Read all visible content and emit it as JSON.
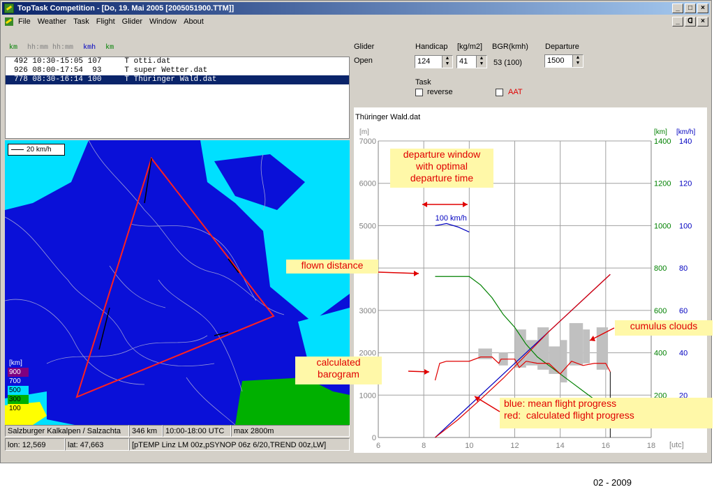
{
  "window": {
    "title": "TopTask Competition - [Do, 19. Mai 2005 [2005051900.TTM]]",
    "buttons": [
      "_",
      "□",
      "×"
    ],
    "mdi_buttons": [
      "_",
      "ᗡ",
      "×"
    ]
  },
  "menu": [
    "File",
    "Weather",
    "Task",
    "Flight",
    "Glider",
    "Window",
    "About"
  ],
  "list": {
    "headers": [
      {
        "text": "km",
        "color": "#008000"
      },
      {
        "text": "hh:mm hh:mm",
        "color": "#808080"
      },
      {
        "text": "kmh",
        "color": "#0000c0"
      },
      {
        "text": "km",
        "color": "#008000"
      }
    ],
    "rows": [
      "492 10:30-15:05 107     T otti.dat",
      "926 08:00-17:54  93     T super Wetter.dat",
      "778 08:30-16:14 100     T Thüringer Wald.dat"
    ],
    "selected_index": 2
  },
  "map": {
    "scale_label": "20 km/h",
    "legend_title": "[km]",
    "legend": [
      {
        "label": "900",
        "color": "#800080",
        "text_color": "#ffffff"
      },
      {
        "label": "700",
        "color": "#0a10d8",
        "text_color": "#ffffff"
      },
      {
        "label": "500",
        "color": "#00e0ff",
        "text_color": "#000000"
      },
      {
        "label": "300",
        "color": "#00b000",
        "text_color": "#000000"
      },
      {
        "label": "100",
        "color": "#ffff00",
        "text_color": "#000000"
      }
    ],
    "status1": [
      "Salzburger Kalkalpen / Salzachta",
      "346 km",
      "10:00-18:00 UTC",
      "max 2800m"
    ],
    "status2": [
      "lon: 12,569",
      "lat: 47,663",
      "[pTEMP Linz LM 00z,pSYNOP 06z 6/20,TREND 00z,LW]"
    ]
  },
  "controls": {
    "glider_label": "Glider",
    "glider_value": "Open",
    "handicap_label": "Handicap",
    "handicap_value": "124",
    "wingload_label": "[kg/m2]",
    "wingload_value": "41",
    "bgr_label": "BGR(kmh)",
    "bgr_value": "53 (100)",
    "departure_label": "Departure",
    "departure_value": "1500",
    "task_label": "Task",
    "reverse_label": "reverse",
    "aat_label": "AAT"
  },
  "chart_data": {
    "type": "line",
    "title": "Thüringer Wald.dat",
    "xlabel": "[utc]",
    "ylabel_left": "[m]",
    "ylabel_right_km": "[km]",
    "ylabel_right_kmh": "[km/h]",
    "xlim": [
      6,
      18
    ],
    "x_ticks": [
      6,
      8,
      10,
      12,
      14,
      16,
      18
    ],
    "ylim": [
      0,
      7000
    ],
    "y_ticks": [
      0,
      1000,
      2000,
      3000,
      4000,
      5000,
      6000,
      7000
    ],
    "y_tick_labels": [
      "0",
      "1000",
      "2000",
      "3000",
      "",
      "5000",
      "6000",
      "7000"
    ],
    "km_ticks": [
      200,
      400,
      600,
      800,
      1000,
      1200,
      1400
    ],
    "kmh_ticks": [
      20,
      40,
      60,
      80,
      100,
      120,
      140
    ],
    "grid": true,
    "colors": {
      "altitude": "#000000",
      "distance": "#008000",
      "speed": "#0000c0",
      "calc": "#e00000",
      "clouds": "#c0c0c0"
    },
    "series": [
      {
        "name": "blue: mean flight progress",
        "x": [
          8.5,
          16.2
        ],
        "y": [
          0,
          3850
        ]
      },
      {
        "name": "red:  calculated flight progress",
        "x": [
          8.5,
          9.5,
          10.5,
          11.5,
          12.5,
          13.5,
          14.5,
          15.5,
          16.2
        ],
        "y": [
          0,
          420,
          900,
          1400,
          1950,
          2500,
          3000,
          3500,
          3850
        ]
      },
      {
        "x": [
          8.5,
          9.0,
          9.5,
          10.0
        ],
        "y": [
          5000,
          5050,
          4970,
          4850
        ]
      },
      {
        "x": [
          8.5,
          10.0,
          10.5,
          11.0,
          11.5,
          12.0,
          12.5,
          13.0,
          13.5,
          14.0,
          14.5,
          15.0,
          15.5,
          16.0,
          16.2
        ],
        "y": [
          3800,
          3800,
          3600,
          3300,
          2900,
          2600,
          2200,
          1900,
          1700,
          1500,
          1300,
          1100,
          900,
          700,
          600
        ]
      },
      {
        "x": [
          8.5,
          8.7,
          9.0,
          9.5,
          10.0,
          10.5,
          11.0,
          11.3,
          11.4,
          12.0,
          12.2,
          12.5,
          13.0,
          13.5,
          14.0,
          14.5,
          15.0,
          15.5,
          16.0,
          16.2
        ],
        "y": [
          1350,
          1750,
          1800,
          1800,
          1800,
          1900,
          1900,
          1750,
          1850,
          1850,
          1650,
          1800,
          1750,
          1750,
          1500,
          1800,
          1700,
          1750,
          1750,
          1550
        ]
      }
    ],
    "clouds": [
      {
        "x0": 10.4,
        "x1": 11.0,
        "y0": 1850,
        "y1": 2100
      },
      {
        "x0": 11.3,
        "x1": 11.7,
        "y0": 1700,
        "y1": 2000
      },
      {
        "x0": 12.0,
        "x1": 12.5,
        "y0": 1650,
        "y1": 2550
      },
      {
        "x0": 12.5,
        "x1": 13.0,
        "y0": 1700,
        "y1": 2300
      },
      {
        "x0": 13.0,
        "x1": 13.5,
        "y0": 1600,
        "y1": 2600
      },
      {
        "x0": 13.5,
        "x1": 14.0,
        "y0": 1500,
        "y1": 2150
      },
      {
        "x0": 14.0,
        "x1": 14.3,
        "y0": 1300,
        "y1": 2300
      },
      {
        "x0": 14.4,
        "x1": 15.0,
        "y0": 1700,
        "y1": 2700
      },
      {
        "x0": 15.0,
        "x1": 15.3,
        "y0": 1750,
        "y1": 2550
      },
      {
        "x0": 15.6,
        "x1": 16.1,
        "y0": 1600,
        "y1": 2600
      }
    ],
    "annotations": [
      {
        "text": "100 km/h",
        "color": "#0000c0"
      }
    ]
  },
  "callouts": {
    "departure": "departure window\nwith optimal\ndeparture time",
    "flown": "flown distance",
    "cumulus": "cumulus clouds",
    "barogram": "calculated\nbarogram",
    "legend_blue": "blue: mean flight progress",
    "legend_red": "red:  calculated flight progress"
  },
  "footer": "02 - 2009"
}
